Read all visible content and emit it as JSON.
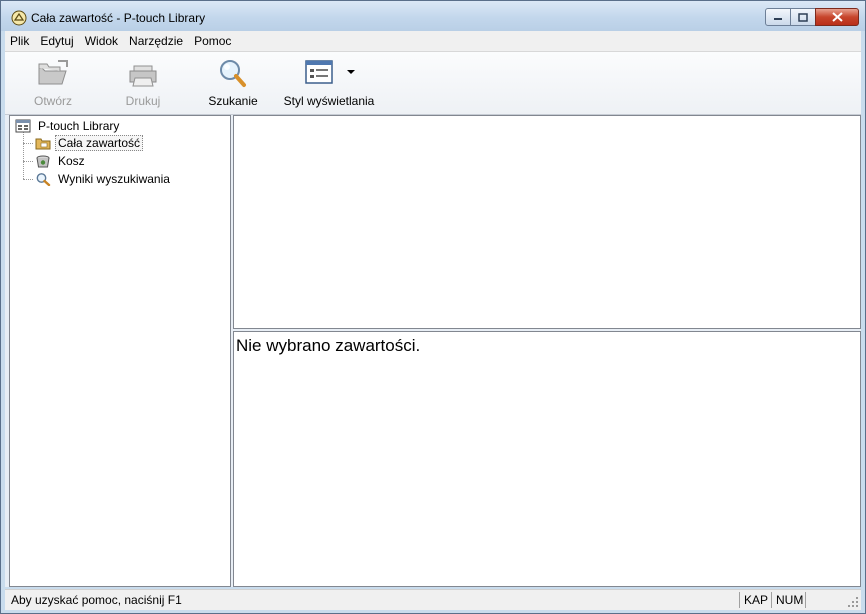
{
  "window": {
    "title": "Cała zawartość - P-touch Library"
  },
  "menu": {
    "items": [
      "Plik",
      "Edytuj",
      "Widok",
      "Narzędzie",
      "Pomoc"
    ]
  },
  "toolbar": {
    "open_label": "Otwórz",
    "print_label": "Drukuj",
    "search_label": "Szukanie",
    "view_style_label": "Styl wyświetlania"
  },
  "tree": {
    "root": "P-touch Library",
    "items": [
      "Cała zawartość",
      "Kosz",
      "Wyniki wyszukiwania"
    ]
  },
  "preview": {
    "message": "Nie wybrano zawartości."
  },
  "status": {
    "help_text": "Aby uzyskać pomoc, naciśnij F1",
    "caps": "KAP",
    "num": "NUM"
  },
  "colors": {
    "titlebar": "#c9dced",
    "close_button": "#c7452c",
    "folder": "#e3b75a"
  }
}
